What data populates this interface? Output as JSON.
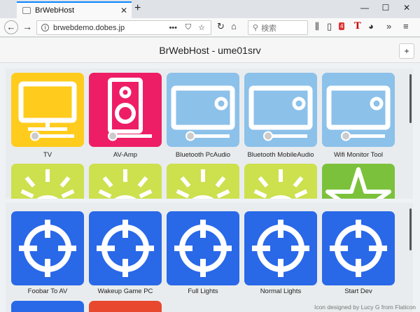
{
  "browser": {
    "tab_title": "BrWebHost",
    "url": "brwebdemo.dobes.jp",
    "search_placeholder": "検索",
    "page_actions": "•••",
    "badge_count": "4"
  },
  "page": {
    "title": "BrWebHost - ume01srv",
    "add_label": "+"
  },
  "colors": {
    "tv": "#ffcc1e",
    "amp": "#ee1e66",
    "monitor": "#8cc1ea",
    "light": "#cde04e",
    "star": "#7cc13b",
    "script": "#2969e8"
  },
  "devices": [
    {
      "label": "TV",
      "icon": "tv-icon",
      "color": "tv"
    },
    {
      "label": "AV-Amp",
      "icon": "speaker-icon",
      "color": "amp"
    },
    {
      "label": "Bluetooth PcAudio",
      "icon": "monitor-icon",
      "color": "monitor"
    },
    {
      "label": "Bluetooth MobileAudio",
      "icon": "monitor-icon",
      "color": "monitor"
    },
    {
      "label": "Wifi Monitor Tool",
      "icon": "monitor-icon",
      "color": "monitor"
    }
  ],
  "devices_row2": [
    {
      "icon": "light-icon",
      "color": "light"
    },
    {
      "icon": "light-icon",
      "color": "light"
    },
    {
      "icon": "light-icon",
      "color": "light"
    },
    {
      "icon": "light-icon",
      "color": "light"
    },
    {
      "icon": "star-icon",
      "color": "star"
    }
  ],
  "scripts": [
    {
      "label": "Foobar To AV",
      "icon": "crosshair-icon"
    },
    {
      "label": "Wakeup Game PC",
      "icon": "crosshair-icon"
    },
    {
      "label": "Full Lights",
      "icon": "crosshair-icon"
    },
    {
      "label": "Normal Lights",
      "icon": "crosshair-icon"
    },
    {
      "label": "Start Dev",
      "icon": "crosshair-icon"
    }
  ],
  "credit": "Icon designed by Lucy G from Flaticon"
}
